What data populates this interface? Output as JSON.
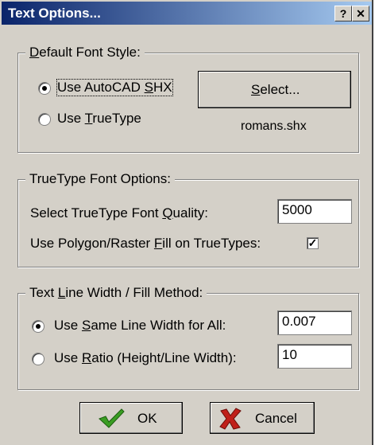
{
  "window": {
    "title": "Text Options...",
    "help_label": "?",
    "close_label": "✕"
  },
  "default_font": {
    "legend_pre": "",
    "legend_u": "D",
    "legend_post": "efault Font Style:",
    "shx_pre": "Use AutoCAD ",
    "shx_u": "S",
    "shx_post": "HX",
    "tt_pre": "Use ",
    "tt_u": "T",
    "tt_post": "rueType",
    "select_u": "S",
    "select_post": "elect...",
    "current_font": "romans.shx"
  },
  "truetype": {
    "legend": "TrueType Font Options:",
    "quality_pre": "Select TrueType Font ",
    "quality_u": "Q",
    "quality_post": "uality:",
    "quality_value": "5000",
    "fill_pre": "Use Polygon/Raster ",
    "fill_u": "F",
    "fill_post": "ill on TrueTypes:",
    "fill_checked": "✓"
  },
  "line_width": {
    "legend_pre": "Text ",
    "legend_u": "L",
    "legend_post": "ine Width / Fill Method:",
    "same_pre": "Use ",
    "same_u": "S",
    "same_post": "ame Line Width for All:",
    "same_value": "0.007",
    "ratio_pre": "Use ",
    "ratio_u": "R",
    "ratio_post": "atio (Height/Line Width):",
    "ratio_value": "10"
  },
  "buttons": {
    "ok": "OK",
    "cancel": "Cancel"
  }
}
